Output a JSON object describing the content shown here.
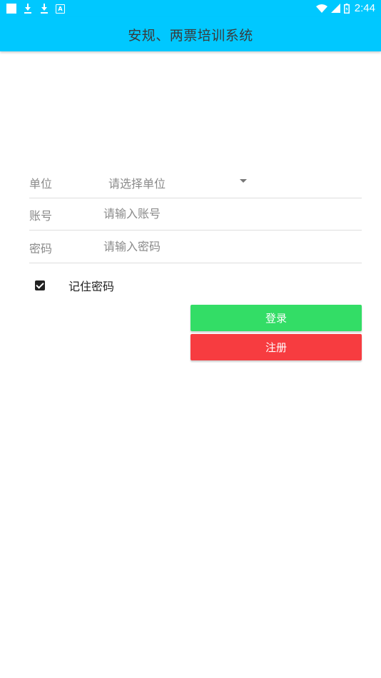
{
  "status_bar": {
    "time": "2:44",
    "left_icons": [
      "image-notification-icon",
      "download-icon",
      "download-icon",
      "app-notification-icon"
    ],
    "right_icons": [
      "wifi-icon",
      "signal-icon",
      "battery-icon"
    ]
  },
  "app_bar": {
    "title": "安规、两票培训系统"
  },
  "form": {
    "unit": {
      "label": "单位",
      "value": "请选择单位"
    },
    "account": {
      "label": "账号",
      "placeholder": "请输入账号"
    },
    "password": {
      "label": "密码",
      "placeholder": "请输入密码"
    },
    "remember": {
      "label": "记住密码",
      "checked": true
    }
  },
  "buttons": {
    "login": "登录",
    "register": "注册"
  },
  "colors": {
    "primary": "#00c8ff",
    "login": "#33dd66",
    "register": "#f73c40"
  }
}
